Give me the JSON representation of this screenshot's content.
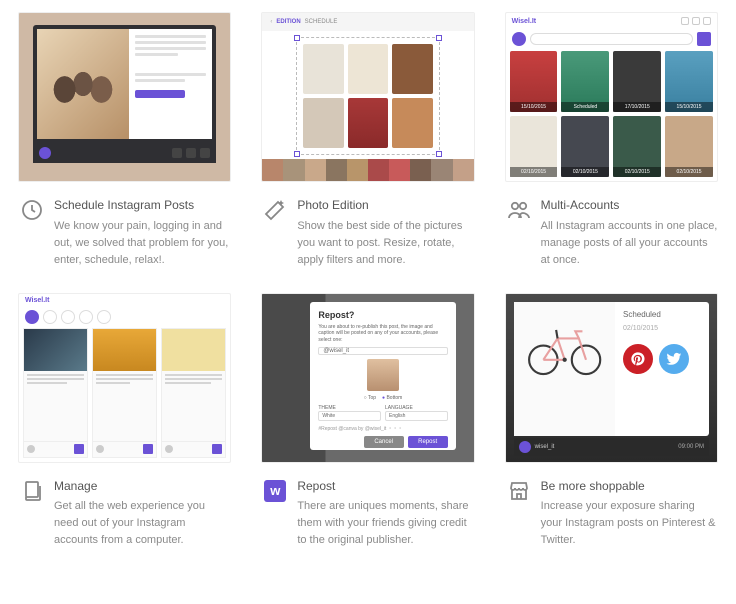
{
  "brand": "Wisel.It",
  "features": [
    {
      "title": "Schedule Instagram Posts",
      "desc": "We know your pain, logging in and out, we solved that problem for you, enter, schedule, relax!."
    },
    {
      "title": "Photo Edition",
      "desc": "Show the best side of the pictures you want to post. Resize, rotate, apply filters and more.",
      "editor_tabs": {
        "active": "EDITION",
        "inactive": "SCHEDULE"
      }
    },
    {
      "title": "Multi-Accounts",
      "desc": "All Instagram accounts in one place, manage posts of all your accounts at once.",
      "tiles": [
        "15/10/2015",
        "Scheduled",
        "17/10/2015",
        "15/10/2015",
        "02/10/2015",
        "02/10/2015",
        "02/10/2015",
        "02/10/2015"
      ]
    },
    {
      "title": "Manage",
      "desc": "Get all the web experience you need out of your Instagram accounts from a computer."
    },
    {
      "title": "Repost",
      "desc": "There are uniques moments, share them with your friends giving credit to the original publisher.",
      "modal": {
        "heading": "Repost?",
        "sub": "You are about to re-publish this post, the image and caption will be posted on any of your accounts, please select one:",
        "account": "@wisel_it",
        "pos_top": "Top",
        "pos_bottom": "Bottom",
        "theme_label": "THEME",
        "theme_value": "White",
        "lang_label": "LANGUAGE",
        "lang_value": "English",
        "caption": "#Repost @canva by @wisel_it ・・・",
        "cancel": "Cancel",
        "repost": "Repost"
      }
    },
    {
      "title": "Be more shoppable",
      "desc": "Increase your exposure sharing your Instagram posts on Pinterest & Twitter.",
      "panel": {
        "status": "Scheduled",
        "date": "02/10/2015",
        "user": "wisel_it",
        "time": "09:00 PM"
      }
    }
  ]
}
